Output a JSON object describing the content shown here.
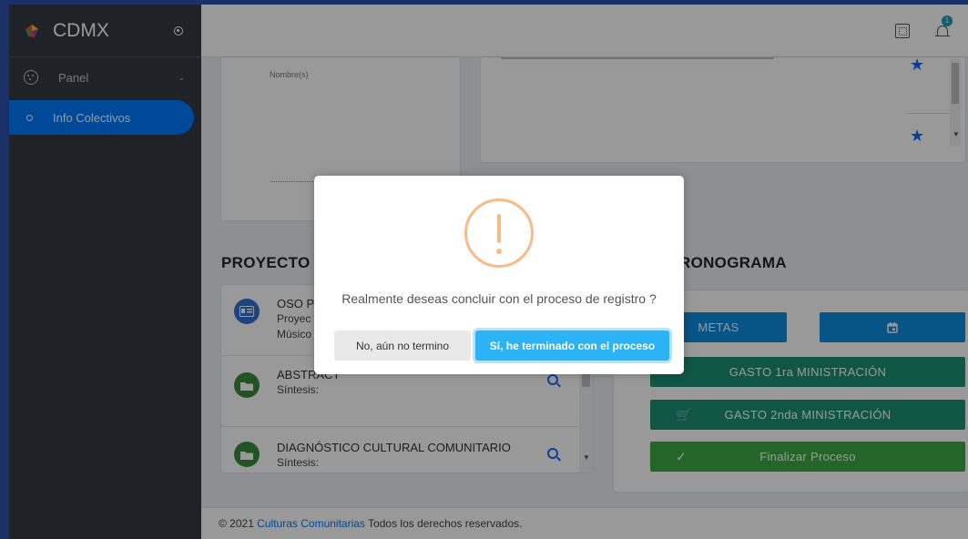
{
  "sidebar": {
    "brand": "CDMX",
    "items": [
      {
        "label": "Panel",
        "icon": "palette-icon"
      },
      {
        "label": "Info Colectivos",
        "icon": "circle-icon"
      }
    ]
  },
  "topnav": {
    "notifications_count": "1"
  },
  "signature_card": {
    "label": "Nombre(s)"
  },
  "project": {
    "title": "PROYECTO",
    "items": [
      {
        "name": "OSO P",
        "line2": "Proyec",
        "line3": "Músico"
      },
      {
        "name": "ABSTRACT",
        "line2": "Síntesis:"
      },
      {
        "name": "DIAGNÓSTICO CULTURAL COMUNITARIO",
        "line2": "Síntesis:"
      }
    ]
  },
  "schedule": {
    "title": "RONOGRAMA",
    "metas_label": "METAS",
    "gasto1_label": "GASTO 1ra MINISTRACIÓN",
    "gasto2_label": "GASTO 2nda MINISTRACIÓN",
    "finalize_label": "Finalizar Proceso"
  },
  "footer": {
    "prefix": "© 2021 ",
    "link": "Culturas Comunitarias",
    "suffix": " Todos los derechos reservados."
  },
  "modal": {
    "message": "Realmente deseas concluir con el proceso de registro ?",
    "cancel_label": "No, aún no termino",
    "confirm_label": "Sí, he terminado con el proceso"
  },
  "colors": {
    "primary": "#007bff",
    "teal": "#1b8f74",
    "green": "#40a845",
    "warning": "#f8bb86",
    "confirm": "#2bb3f5"
  }
}
